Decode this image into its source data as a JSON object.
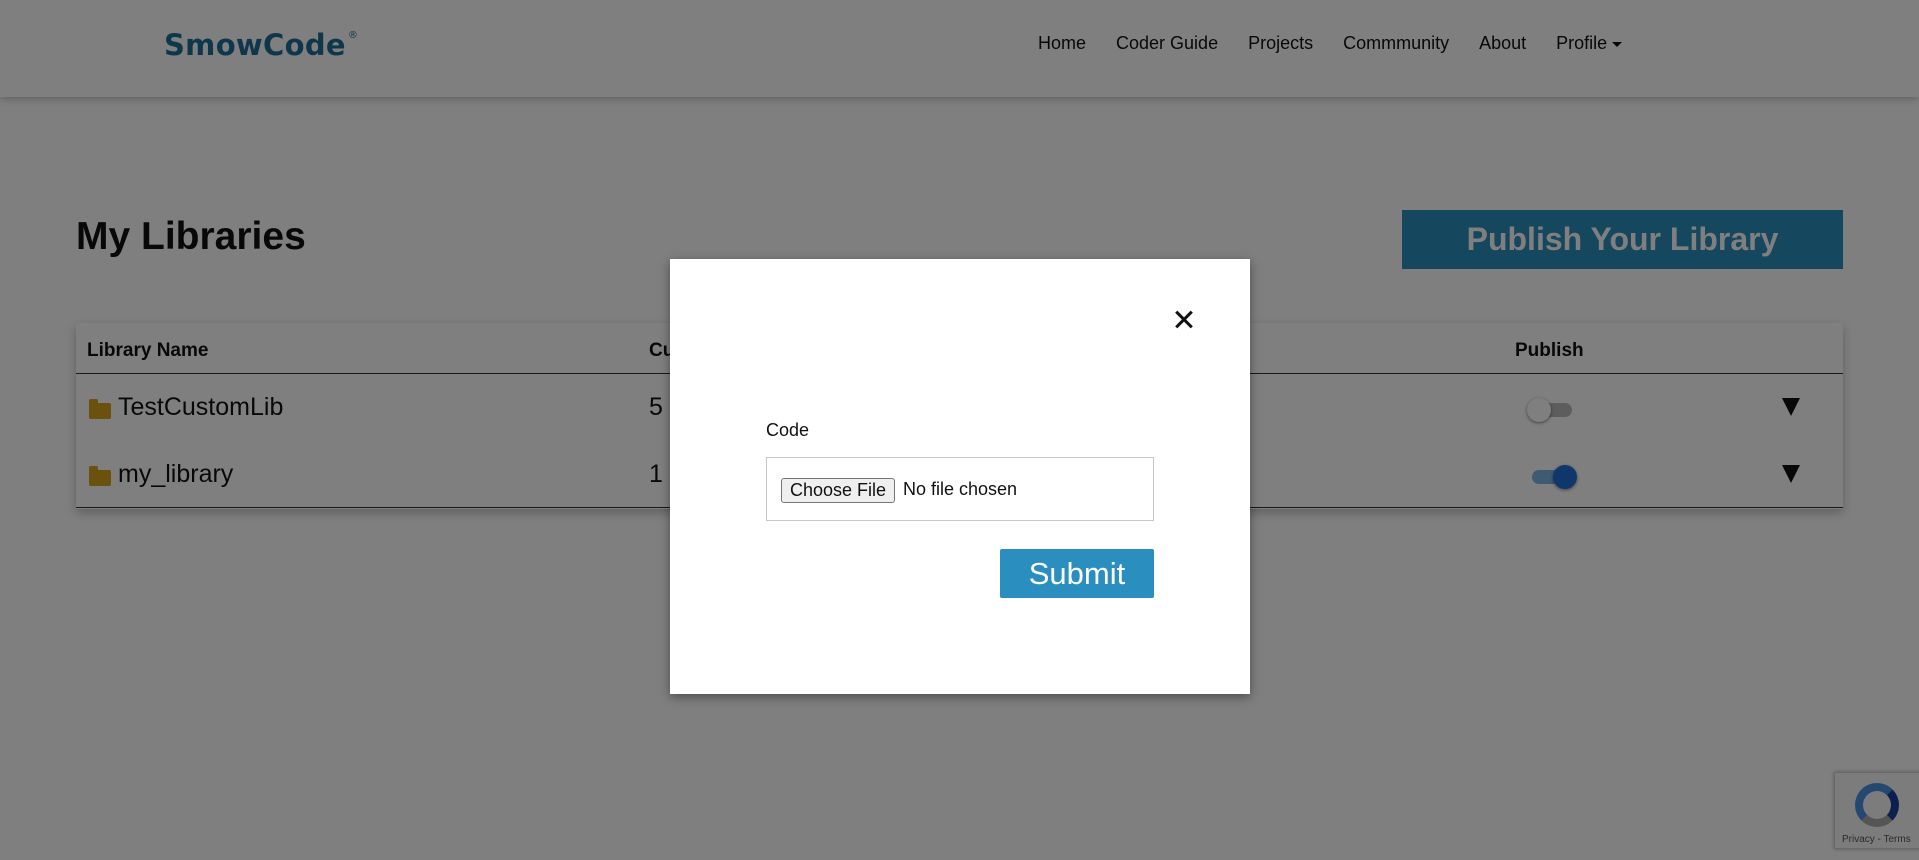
{
  "header": {
    "brand": "SmowCode",
    "brand_mark": "®",
    "nav": [
      "Home",
      "Coder Guide",
      "Projects",
      "Commmunity",
      "About",
      "Profile"
    ]
  },
  "main": {
    "title": "My Libraries",
    "publish_button": "Publish Your Library",
    "table": {
      "columns": {
        "name": "Library Name",
        "count": "Cu",
        "publish": "Publish"
      },
      "rows": [
        {
          "name": "TestCustomLib",
          "count": "5",
          "published": false
        },
        {
          "name": "my_library",
          "count": "1",
          "published": true
        }
      ]
    }
  },
  "modal": {
    "field_label": "Code",
    "choose_file": "Choose File",
    "file_status": "No file chosen",
    "submit": "Submit"
  },
  "recaptcha": {
    "links": "Privacy - Terms"
  },
  "colors": {
    "brand": "#1f6f97",
    "accent": "#2a8fbf",
    "toggle_on": "#1e6fd9",
    "folder": "#d6a21c"
  },
  "icons": {
    "close": "close-icon",
    "folder": "folder-icon",
    "expand": "caret-down-icon"
  }
}
